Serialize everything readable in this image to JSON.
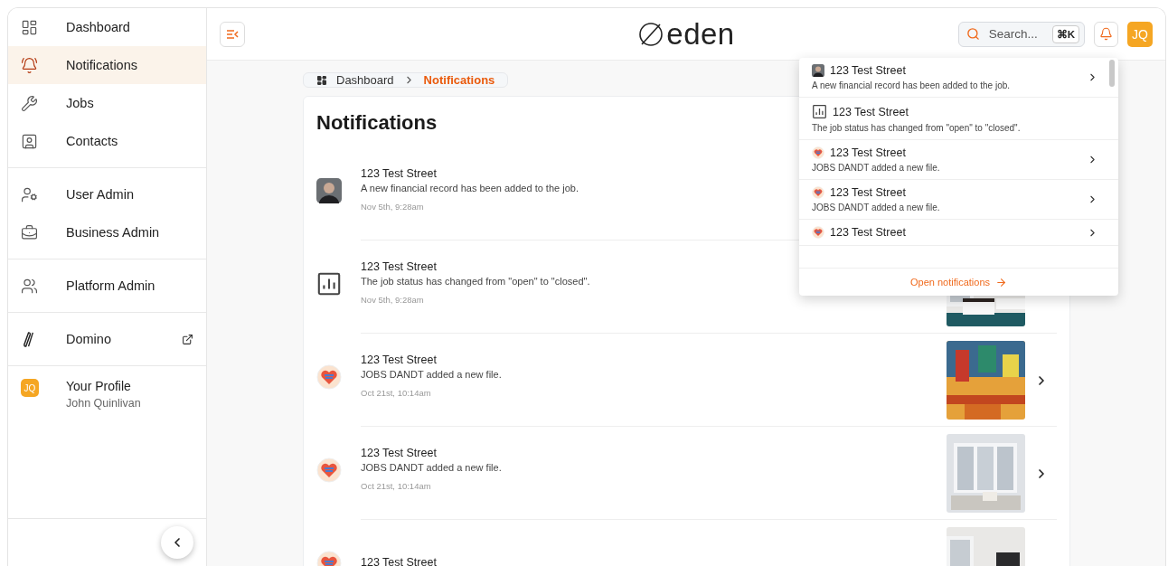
{
  "sidebar": {
    "sections": [
      {
        "items": [
          {
            "label": "Dashboard",
            "kind": "dashboard",
            "selected": false
          },
          {
            "label": "Notifications",
            "kind": "bell",
            "selected": true
          },
          {
            "label": "Jobs",
            "kind": "tools",
            "selected": false
          },
          {
            "label": "Contacts",
            "kind": "contact",
            "selected": false
          }
        ]
      },
      {
        "items": [
          {
            "label": "User Admin",
            "kind": "user-gear",
            "selected": false
          },
          {
            "label": "Business Admin",
            "kind": "briefcase",
            "selected": false
          }
        ]
      },
      {
        "items": [
          {
            "label": "Platform Admin",
            "kind": "users-gear",
            "selected": false
          }
        ]
      },
      {
        "items": [
          {
            "label": "Domino",
            "kind": "domino",
            "selected": false,
            "external": true
          }
        ]
      }
    ],
    "profile": {
      "initials": "JQ",
      "title": "Your Profile",
      "name": "John Quinlivan"
    }
  },
  "header": {
    "logo": "eden",
    "search": {
      "placeholder": "Search...",
      "shortcut": "⌘K"
    },
    "avatar": "JQ"
  },
  "breadcrumb": [
    {
      "label": "Dashboard",
      "selected": false
    },
    {
      "label": "Notifications",
      "selected": true
    }
  ],
  "page": {
    "title": "Notifications",
    "rows": [
      {
        "kind": "person",
        "title": "123 Test Street",
        "message": "A new financial record has been added to the job.",
        "time": "Nov 5th, 9:28am",
        "picture": false,
        "chevron": false
      },
      {
        "kind": "chart",
        "title": "123 Test Street",
        "message": "The job status has changed from \"open\" to \"closed\".",
        "time": "Nov 5th, 9:28am",
        "picture": true,
        "chevron": false
      },
      {
        "kind": "logo",
        "title": "123 Test Street",
        "message": "JOBS DANDT added a new file.",
        "time": "Oct 21st, 10:14am",
        "picture": true,
        "chevron": true
      },
      {
        "kind": "logo",
        "title": "123 Test Street",
        "message": "JOBS DANDT added a new file.",
        "time": "Oct 21st, 10:14am",
        "picture": true,
        "chevron": true
      },
      {
        "kind": "logo",
        "title": "123 Test Street",
        "picture": true,
        "chevron": false
      }
    ]
  },
  "dropdown": {
    "items": [
      {
        "kind": "person",
        "title": "123 Test Street",
        "message": "A new financial record has been added to the job.",
        "chevron": true
      },
      {
        "kind": "chart",
        "title": "123 Test Street",
        "message": "The job status has changed from \"open\" to \"closed\".",
        "chevron": false
      },
      {
        "kind": "logo",
        "title": "123 Test Street",
        "message": "JOBS DANDT added a new file.",
        "chevron": true
      },
      {
        "kind": "logo",
        "title": "123 Test Street",
        "message": "JOBS DANDT added a new file.",
        "chevron": true
      },
      {
        "kind": "logo",
        "title": "123 Test Street",
        "chevron": true
      }
    ],
    "footer": "Open notifications"
  }
}
